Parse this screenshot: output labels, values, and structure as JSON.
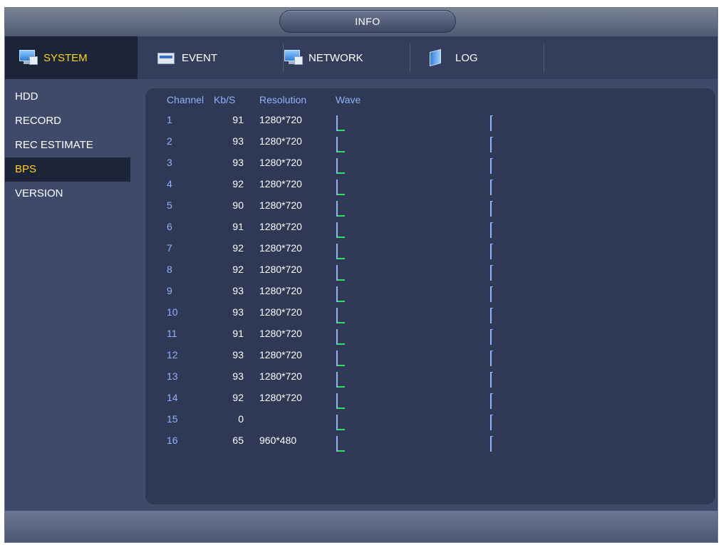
{
  "title": "INFO",
  "tabs": [
    {
      "label": "SYSTEM",
      "icon": "monitor-icon",
      "active": true
    },
    {
      "label": "EVENT",
      "icon": "event-icon",
      "active": false
    },
    {
      "label": "NETWORK",
      "icon": "network-icon",
      "active": false
    },
    {
      "label": "LOG",
      "icon": "log-icon",
      "active": false
    }
  ],
  "sidebar": {
    "items": [
      {
        "label": "HDD",
        "active": false
      },
      {
        "label": "RECORD",
        "active": false
      },
      {
        "label": "REC ESTIMATE",
        "active": false
      },
      {
        "label": "BPS",
        "active": true
      },
      {
        "label": "VERSION",
        "active": false
      }
    ]
  },
  "table": {
    "headers": {
      "channel": "Channel",
      "kbs": "Kb/S",
      "resolution": "Resolution",
      "wave": "Wave"
    },
    "rows": [
      {
        "channel": "1",
        "kbs": "91",
        "resolution": "1280*720"
      },
      {
        "channel": "2",
        "kbs": "93",
        "resolution": "1280*720"
      },
      {
        "channel": "3",
        "kbs": "93",
        "resolution": "1280*720"
      },
      {
        "channel": "4",
        "kbs": "92",
        "resolution": "1280*720"
      },
      {
        "channel": "5",
        "kbs": "90",
        "resolution": "1280*720"
      },
      {
        "channel": "6",
        "kbs": "91",
        "resolution": "1280*720"
      },
      {
        "channel": "7",
        "kbs": "92",
        "resolution": "1280*720"
      },
      {
        "channel": "8",
        "kbs": "92",
        "resolution": "1280*720"
      },
      {
        "channel": "9",
        "kbs": "93",
        "resolution": "1280*720"
      },
      {
        "channel": "10",
        "kbs": "93",
        "resolution": "1280*720"
      },
      {
        "channel": "11",
        "kbs": "91",
        "resolution": "1280*720"
      },
      {
        "channel": "12",
        "kbs": "93",
        "resolution": "1280*720"
      },
      {
        "channel": "13",
        "kbs": "93",
        "resolution": "1280*720"
      },
      {
        "channel": "14",
        "kbs": "92",
        "resolution": "1280*720"
      },
      {
        "channel": "15",
        "kbs": "0",
        "resolution": ""
      },
      {
        "channel": "16",
        "kbs": "65",
        "resolution": "960*480"
      }
    ]
  },
  "colors": {
    "active_text": "#ffd21f",
    "header_text": "#8fb3ff",
    "wave_level": "#2fe05a",
    "panel_bg": "#2f3955"
  }
}
